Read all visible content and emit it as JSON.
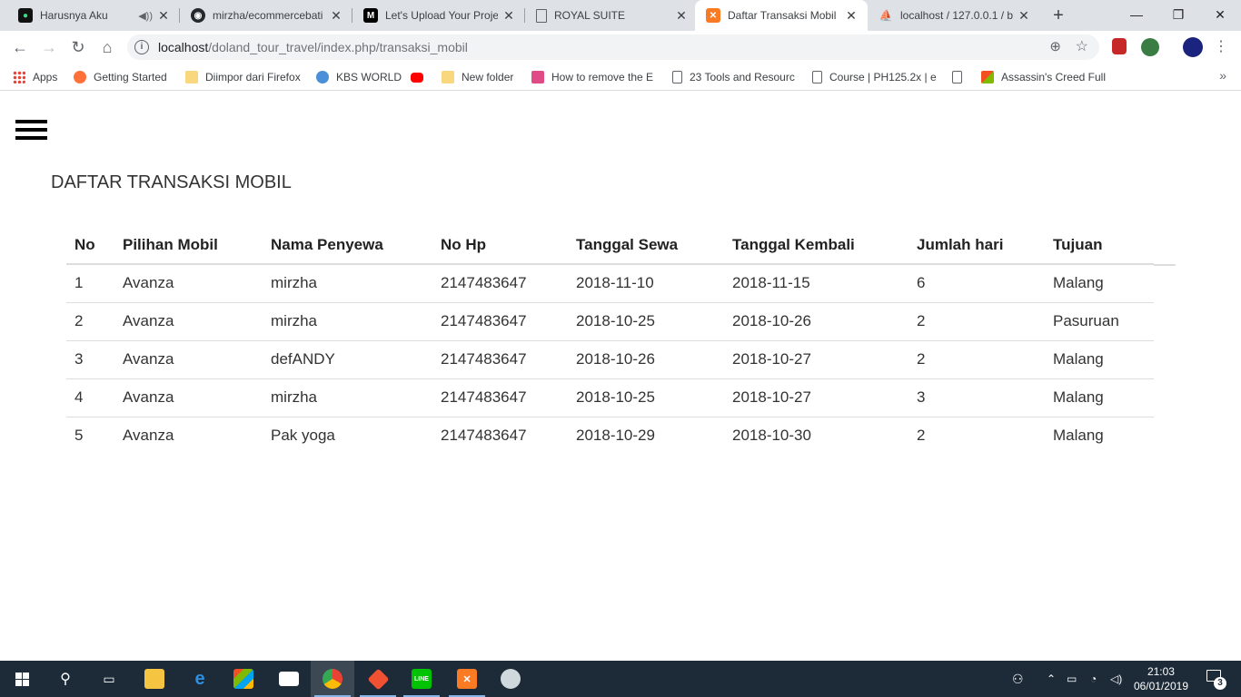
{
  "browser": {
    "tabs": [
      {
        "title": "Harusnya Aku",
        "favicon": "green-music-icon",
        "audio": true
      },
      {
        "title": "mirzha/ecommercebati",
        "favicon": "github-icon"
      },
      {
        "title": "Let's Upload Your Proje",
        "favicon": "medium-icon"
      },
      {
        "title": "ROYAL SUITE",
        "favicon": "page-icon"
      },
      {
        "title": "Daftar Transaksi Mobil",
        "favicon": "xampp-icon",
        "active": true
      },
      {
        "title": "localhost / 127.0.0.1 / b",
        "favicon": "phpmyadmin-icon"
      }
    ],
    "url_host": "localhost",
    "url_path": "/doland_tour_travel/index.php/transaksi_mobil",
    "bookmarks": [
      {
        "label": "Apps",
        "icon": "apps-grid-icon"
      },
      {
        "label": "Getting Started",
        "icon": "firefox-icon"
      },
      {
        "label": "Diimpor dari Firefox",
        "icon": "folder-icon"
      },
      {
        "label": "KBS WORLD",
        "icon": "kbs-icon"
      },
      {
        "label": "",
        "icon": "youtube-icon"
      },
      {
        "label": "New folder",
        "icon": "folder-icon"
      },
      {
        "label": "How to remove the E",
        "icon": "bookmark-image-icon"
      },
      {
        "label": "23 Tools and Resourc",
        "icon": "page-icon"
      },
      {
        "label": "Course | PH125.2x | e",
        "icon": "page-icon"
      },
      {
        "label": "",
        "icon": "page-icon"
      },
      {
        "label": "Assassin's Creed Full",
        "icon": "windows-flag-icon"
      }
    ]
  },
  "page": {
    "title": "DAFTAR TRANSAKSI MOBIL",
    "table": {
      "headers": [
        "No",
        "Pilihan Mobil",
        "Nama Penyewa",
        "No Hp",
        "Tanggal Sewa",
        "Tanggal Kembali",
        "Jumlah hari",
        "Tujuan"
      ],
      "rows": [
        [
          "1",
          "Avanza",
          "mirzha",
          "2147483647",
          "2018-11-10",
          "2018-11-15",
          "6",
          "Malang"
        ],
        [
          "2",
          "Avanza",
          "mirzha",
          "2147483647",
          "2018-10-25",
          "2018-10-26",
          "2",
          "Pasuruan"
        ],
        [
          "3",
          "Avanza",
          "defANDY",
          "2147483647",
          "2018-10-26",
          "2018-10-27",
          "2",
          "Malang"
        ],
        [
          "4",
          "Avanza",
          "mirzha",
          "2147483647",
          "2018-10-25",
          "2018-10-27",
          "3",
          "Malang"
        ],
        [
          "5",
          "Avanza",
          "Pak yoga",
          "2147483647",
          "2018-10-29",
          "2018-10-30",
          "2",
          "Malang"
        ]
      ]
    }
  },
  "taskbar": {
    "time": "21:03",
    "date": "06/01/2019",
    "notification_count": "3"
  }
}
